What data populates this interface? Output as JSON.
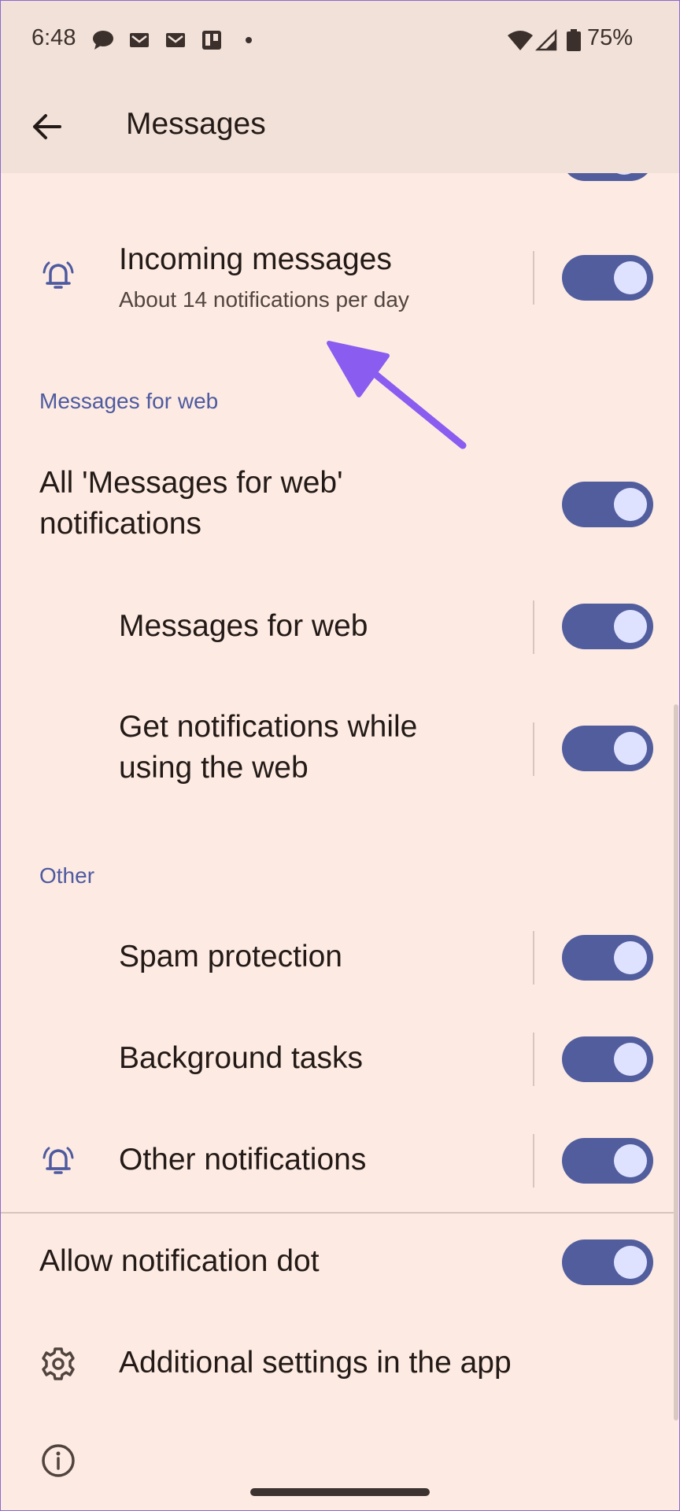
{
  "status_bar": {
    "time": "6:48",
    "battery": "75%"
  },
  "app_bar": {
    "title": "Messages"
  },
  "rows": {
    "incoming": {
      "title": "Incoming messages",
      "subtitle": "About 14 notifications per day"
    },
    "all_web": {
      "title_line1": "All 'Messages for web'",
      "title_line2": "notifications"
    },
    "web": {
      "title": "Messages for web"
    },
    "notif_web": {
      "title_line1": "Get notifications while",
      "title_line2": "using the web"
    },
    "spam": {
      "title": "Spam protection"
    },
    "background": {
      "title": "Background tasks"
    },
    "other_notif": {
      "title": "Other notifications"
    },
    "dot": {
      "title": "Allow notification dot"
    },
    "additional": {
      "title": "Additional settings in the app"
    }
  },
  "sections": {
    "web": "Messages for web",
    "other": "Other"
  },
  "toggles": {
    "all_on": true
  },
  "colors": {
    "accent": "#515d9d",
    "background": "#fdebe3",
    "annotation_arrow": "#8a5cf0"
  }
}
